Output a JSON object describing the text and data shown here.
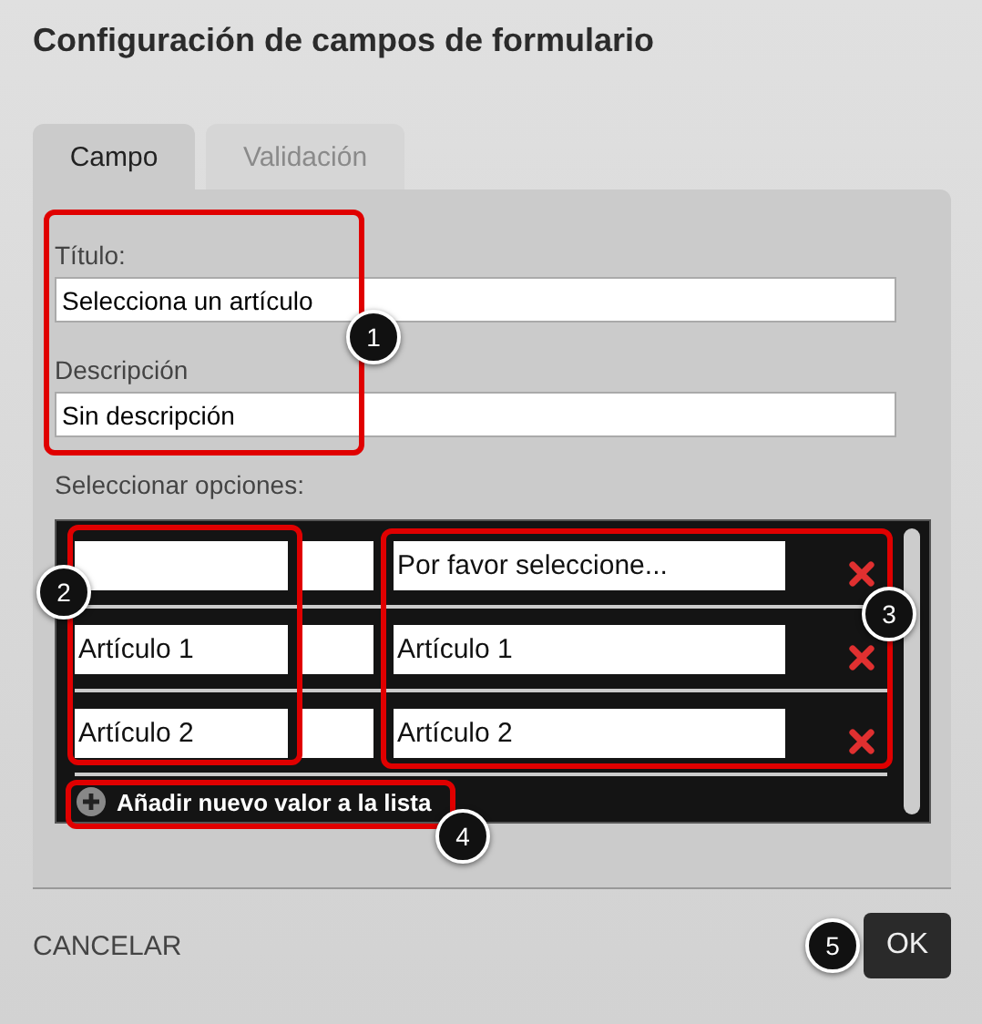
{
  "dialog": {
    "title": "Configuración de campos de formulario"
  },
  "tabs": [
    {
      "label": "Campo",
      "selected": true
    },
    {
      "label": "Validación",
      "selected": false
    }
  ],
  "fields": [
    {
      "label": "Título:",
      "value": "Selecciona un artículo"
    },
    {
      "label": "Descripción",
      "value": "Sin descripción"
    }
  ],
  "options": {
    "label": "Seleccionar opciones:",
    "rows": [
      {
        "value": "",
        "label": "Por favor seleccione..."
      },
      {
        "value": "Artículo 1",
        "label": "Artículo 1"
      },
      {
        "value": "Artículo 2",
        "label": "Artículo 2"
      }
    ],
    "add_label": "Añadir nuevo valor a la lista"
  },
  "footer": {
    "cancel": "CANCELAR",
    "ok": "OK"
  },
  "annotations": [
    {
      "number": "1"
    },
    {
      "number": "2"
    },
    {
      "number": "3"
    },
    {
      "number": "4"
    },
    {
      "number": "5"
    }
  ]
}
